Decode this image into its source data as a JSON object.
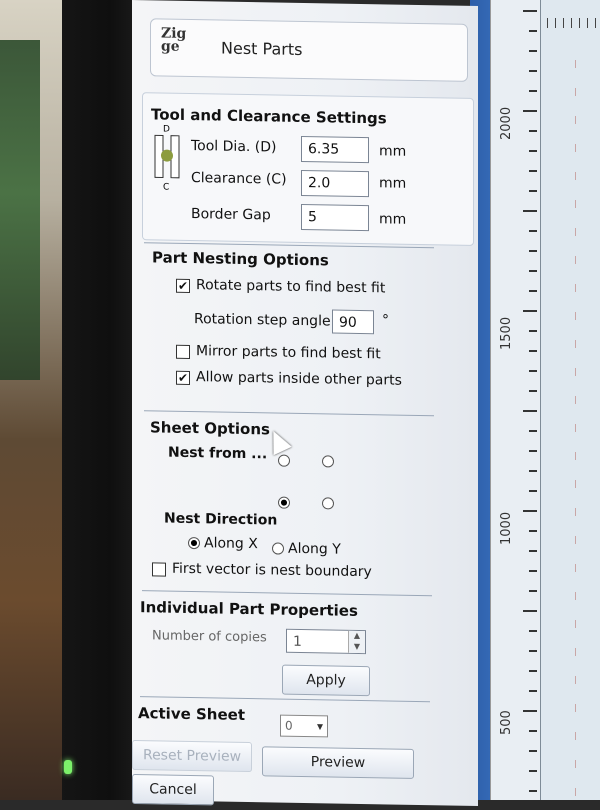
{
  "app": {
    "logo_text": "Zig ge",
    "panel_title": "Nest Parts"
  },
  "tool_clearance": {
    "title": "Tool and Clearance Settings",
    "diagram_labels": {
      "top": "D",
      "bottom": "C"
    },
    "tool_dia_label": "Tool Dia. (D)",
    "tool_dia_value": "6.35",
    "clearance_label": "Clearance (C)",
    "clearance_value": "2.0",
    "border_gap_label": "Border Gap",
    "border_gap_value": "5",
    "unit": "mm"
  },
  "nesting_options": {
    "title": "Part Nesting Options",
    "rotate_label": "Rotate parts to find best fit",
    "rotate_checked": true,
    "rotation_step_label": "Rotation step angle",
    "rotation_step_value": "90",
    "rotation_unit": "°",
    "mirror_label": "Mirror parts to find best fit",
    "mirror_checked": false,
    "allow_inside_label": "Allow parts inside other parts",
    "allow_inside_checked": true
  },
  "sheet_options": {
    "title": "Sheet Options",
    "nest_from_label": "Nest from ...",
    "nest_direction_label": "Nest Direction",
    "along_x_label": "Along X",
    "along_y_label": "Along Y",
    "direction_selected": "Along X",
    "first_vector_label": "First vector is nest boundary",
    "first_vector_checked": false
  },
  "part_properties": {
    "title": "Individual Part Properties",
    "copies_label": "Number of copies",
    "copies_value": "1",
    "apply_label": "Apply"
  },
  "active_sheet": {
    "label": "Active Sheet",
    "value": "0"
  },
  "footer": {
    "reset_label": "Reset Preview",
    "preview_label": "Preview",
    "cancel_label": "Cancel"
  },
  "ruler": {
    "labels": [
      "2000",
      "1500",
      "1000",
      "500"
    ]
  },
  "colors": {
    "workspace_blue": "#356cb7",
    "panel_bg": "#f4f5f7",
    "led_green": "#7cf06a"
  }
}
